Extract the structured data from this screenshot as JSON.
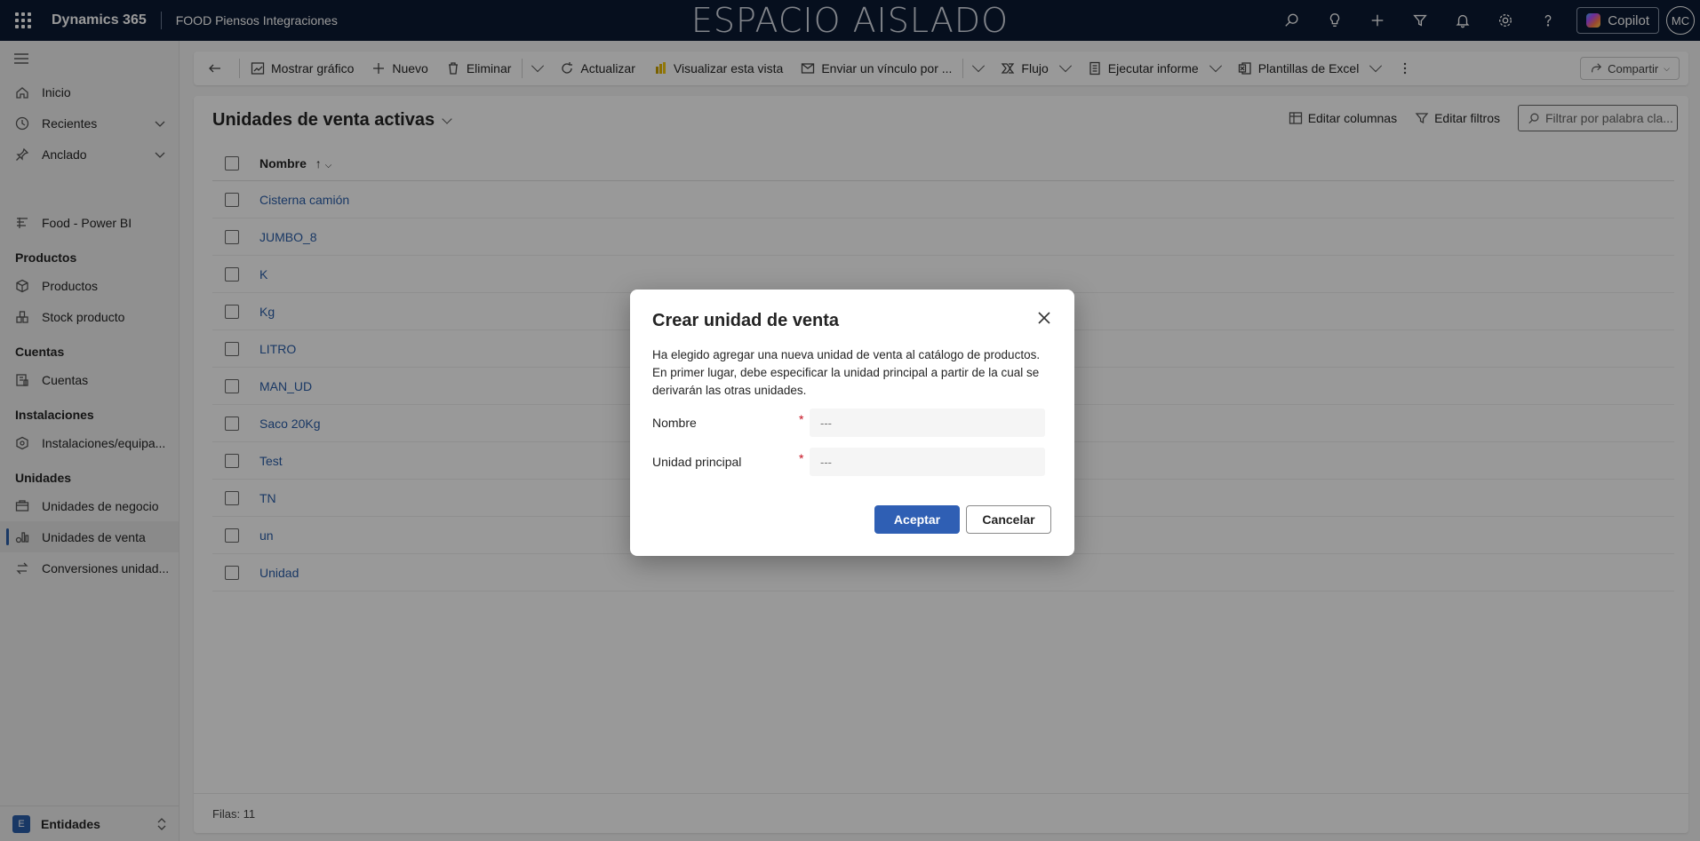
{
  "topbar": {
    "app_name": "Dynamics 365",
    "environment": "FOOD Piensos Integraciones",
    "sandbox_label": "ESPACIO AISLADO",
    "copilot_label": "Copilot",
    "avatar_initials": "MC"
  },
  "sidebar": {
    "top_items": [
      {
        "label": "Inicio"
      },
      {
        "label": "Recientes"
      },
      {
        "label": "Anclado"
      }
    ],
    "power_bi": "Food - Power BI",
    "groups": {
      "productos": {
        "title": "Productos",
        "items": [
          "Productos",
          "Stock producto"
        ]
      },
      "cuentas": {
        "title": "Cuentas",
        "items": [
          "Cuentas"
        ]
      },
      "instalaciones": {
        "title": "Instalaciones",
        "items": [
          "Instalaciones/equipa..."
        ]
      },
      "unidades": {
        "title": "Unidades",
        "items": [
          "Unidades de negocio",
          "Unidades de venta",
          "Conversiones unidad..."
        ]
      }
    },
    "area_badge": "E",
    "area_label": "Entidades"
  },
  "commandbar": {
    "mostrar_grafico": "Mostrar gráfico",
    "nuevo": "Nuevo",
    "eliminar": "Eliminar",
    "actualizar": "Actualizar",
    "visualizar": "Visualizar esta vista",
    "enviar": "Enviar un vínculo por ...",
    "flujo": "Flujo",
    "ejecutar": "Ejecutar informe",
    "plantillas": "Plantillas de Excel",
    "compartir": "Compartir"
  },
  "view": {
    "title": "Unidades de venta activas",
    "editar_columnas": "Editar columnas",
    "editar_filtros": "Editar filtros",
    "filter_placeholder": "Filtrar por palabra cla...",
    "column_nombre": "Nombre",
    "sort_indicator": "↑",
    "rows": [
      "Cisterna camión",
      "JUMBO_8",
      "K",
      "Kg",
      "LITRO",
      "MAN_UD",
      "Saco 20Kg",
      "Test",
      "TN",
      "un",
      "Unidad"
    ],
    "row_count": "Filas: 11"
  },
  "dialog": {
    "title": "Crear unidad de venta",
    "description": "Ha elegido agregar una nueva unidad de venta al catálogo de productos. En primer lugar, debe especificar la unidad principal a partir de la cual se derivarán las otras unidades.",
    "field_nombre_label": "Nombre",
    "field_nombre_value": "---",
    "field_unidad_label": "Unidad principal",
    "field_unidad_value": "---",
    "required_mark": "*",
    "accept_label": "Aceptar",
    "cancel_label": "Cancelar"
  },
  "colors": {
    "topbar_bg": "#0b1a33",
    "accent": "#2f5fb4",
    "link": "#2b5ea8",
    "required": "#c50f1f"
  }
}
